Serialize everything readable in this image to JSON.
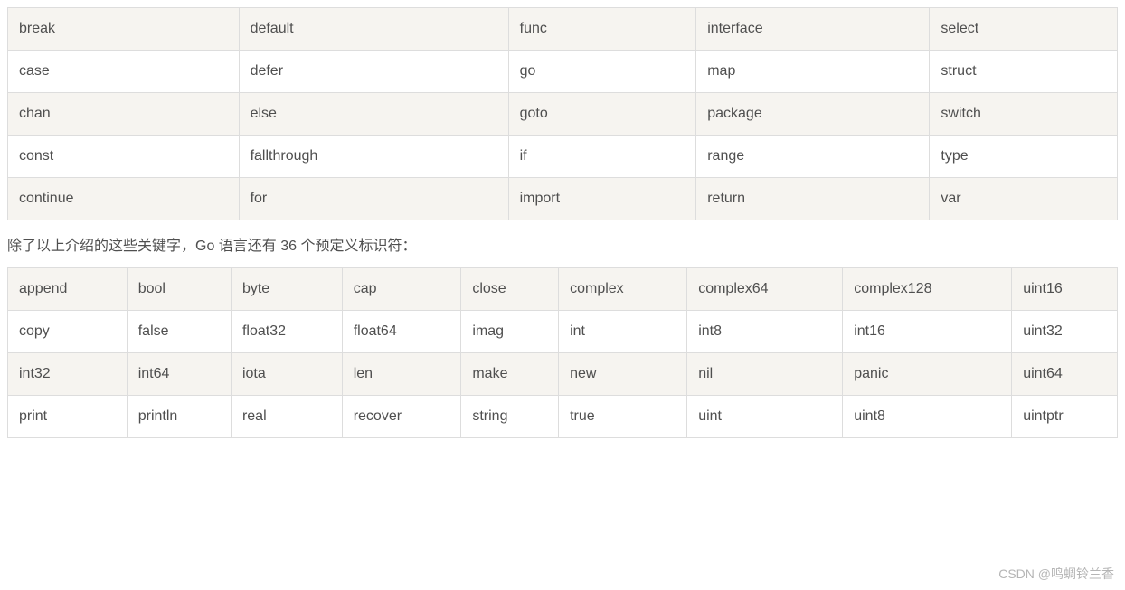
{
  "keywords_table": {
    "rows": [
      [
        "break",
        "default",
        "func",
        "interface",
        "select"
      ],
      [
        "case",
        "defer",
        "go",
        "map",
        "struct"
      ],
      [
        "chan",
        "else",
        "goto",
        "package",
        "switch"
      ],
      [
        "const",
        "fallthrough",
        "if",
        "range",
        "type"
      ],
      [
        "continue",
        "for",
        "import",
        "return",
        "var"
      ]
    ]
  },
  "intro_text": "除了以上介绍的这些关键字，Go 语言还有 36 个预定义标识符：",
  "identifiers_table": {
    "rows": [
      [
        "append",
        "bool",
        "byte",
        "cap",
        "close",
        "complex",
        "complex64",
        "complex128",
        "uint16"
      ],
      [
        "copy",
        "false",
        "float32",
        "float64",
        "imag",
        "int",
        "int8",
        "int16",
        "uint32"
      ],
      [
        "int32",
        "int64",
        "iota",
        "len",
        "make",
        "new",
        "nil",
        "panic",
        "uint64"
      ],
      [
        "print",
        "println",
        "real",
        "recover",
        "string",
        "true",
        "uint",
        "uint8",
        "uintptr"
      ]
    ]
  },
  "watermark": "CSDN @鸣蜩铃兰香"
}
